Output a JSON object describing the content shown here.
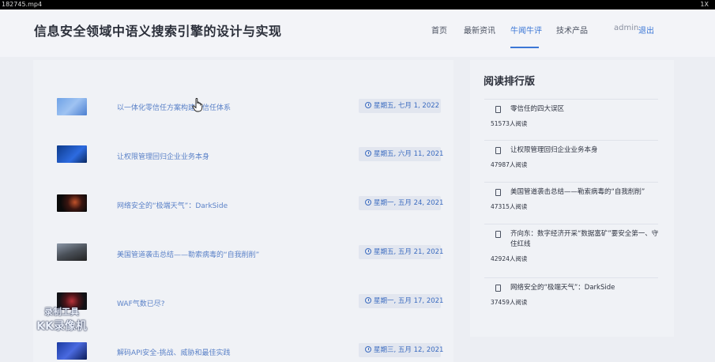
{
  "player": {
    "filename": "182745.mp4",
    "zoom": "1X"
  },
  "site": {
    "title": "信息安全领域中语义搜索引擎的设计与实现"
  },
  "nav": [
    {
      "label": "首页"
    },
    {
      "label": "最新资讯"
    },
    {
      "label": "牛闻牛评"
    },
    {
      "label": "技术产品"
    }
  ],
  "user": {
    "name": "admin",
    "logout": "退出"
  },
  "articles": [
    {
      "title": "以一体化零信任方案构建新信任体系",
      "date": "星期五, 七月 1, 2022"
    },
    {
      "title": "让权限管理回归企业业务本身",
      "date": "星期五, 六月 11, 2021"
    },
    {
      "title": "网络安全的“极端天气”：DarkSide",
      "date": "星期一, 五月 24, 2021"
    },
    {
      "title": "美国管道袭击总结——勒索病毒的“自我削削”",
      "date": "星期五, 五月 21, 2021"
    },
    {
      "title": "WAF气数已尽?",
      "date": "星期一, 五月 17, 2021"
    },
    {
      "title": "解码API安全-挑战、威胁和最佳实践",
      "date": "星期三, 五月 12, 2021"
    }
  ],
  "ranking": {
    "title": "阅读排行版",
    "items": [
      {
        "title": "零信任的四大误区",
        "count": "51573人阅读"
      },
      {
        "title": "让权限管理回归企业业务本身",
        "count": "47987人阅读"
      },
      {
        "title": "美国管道袭击总结——勒索病毒的“自我削削”",
        "count": "47315人阅读"
      },
      {
        "title": "齐向东：数字经济开采“数据富矿”要安全第一、守住红线",
        "count": "42924人阅读"
      },
      {
        "title": "网络安全的“极端天气”：DarkSide",
        "count": "37459人阅读"
      }
    ]
  },
  "watermark": {
    "line1": "录制工具",
    "line2": "KK录像机"
  }
}
